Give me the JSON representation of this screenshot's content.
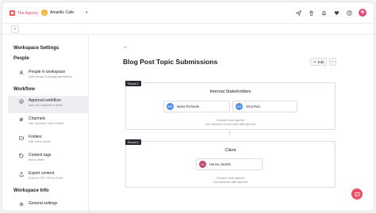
{
  "brand": {
    "name": "The Agency"
  },
  "workspace": {
    "name": "Amarillo Cafe",
    "initial": "A"
  },
  "sidebar": {
    "title": "Workspace Settings",
    "sections": {
      "people": "People",
      "workflow": "Workflow",
      "workspace_info": "Workspace Info"
    },
    "items": [
      {
        "label": "People in workspace",
        "desc": "Invite people & manage permissions"
      },
      {
        "label": "Approval workflow",
        "desc": "Add, edit, duplicate or delete"
      },
      {
        "label": "Channels",
        "desc": "Add, reconnect, edit or delete"
      },
      {
        "label": "Folders",
        "desc": "Add, edit or delete"
      },
      {
        "label": "Content tags",
        "desc": "Edit or delete"
      },
      {
        "label": "Export content",
        "desc": "Export in PDF, CSV or Excel"
      },
      {
        "label": "General settings",
        "desc": ""
      }
    ]
  },
  "main": {
    "page_title": "Blog Post Topic Submissions",
    "edit_label": "Edit",
    "more_label": "···",
    "rounds": [
      {
        "badge": "Round 1",
        "title": "Internal Stakeholders",
        "people": [
          {
            "name": "Maria Richards",
            "initials": "MR",
            "color": "#4f8fe8"
          },
          {
            "name": "Gina Ruiz",
            "initials": "GR",
            "color": "#4f8fe8"
          }
        ],
        "note_line1": "Everyone must approve",
        "note_line2": "Auto-advances to next round after approval"
      },
      {
        "badge": "Round 2",
        "title": "Client",
        "people": [
          {
            "name": "Hanna Jacobs",
            "initials": "HJ",
            "color": "#c0486e"
          }
        ],
        "note_line1": "Everyone must approve",
        "note_line2": "Auto-advances after approval"
      }
    ]
  }
}
